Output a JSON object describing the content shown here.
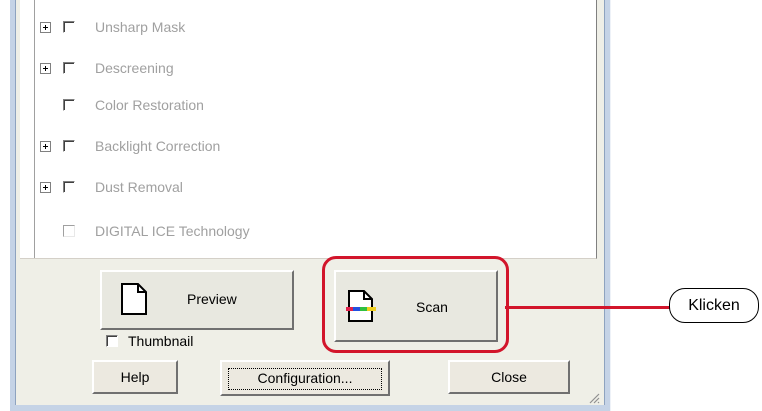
{
  "options": [
    {
      "label": "Unsharp Mask",
      "expandable": true,
      "enabled": false
    },
    {
      "label": "Descreening",
      "expandable": true,
      "enabled": false
    },
    {
      "label": "Color Restoration",
      "expandable": false,
      "enabled": false
    },
    {
      "label": "Backlight Correction",
      "expandable": true,
      "enabled": false
    },
    {
      "label": "Dust Removal",
      "expandable": true,
      "enabled": false
    },
    {
      "label": "DIGITAL ICE Technology",
      "expandable": false,
      "enabled": false
    }
  ],
  "buttons": {
    "preview": "Preview",
    "scan": "Scan",
    "help": "Help",
    "configuration": "Configuration...",
    "close": "Close"
  },
  "thumbnail": {
    "label": "Thumbnail",
    "checked": false
  },
  "callout": {
    "text": "Klicken"
  },
  "colors": {
    "highlight": "#d2152b",
    "disabled_text": "#a0a0a0"
  }
}
